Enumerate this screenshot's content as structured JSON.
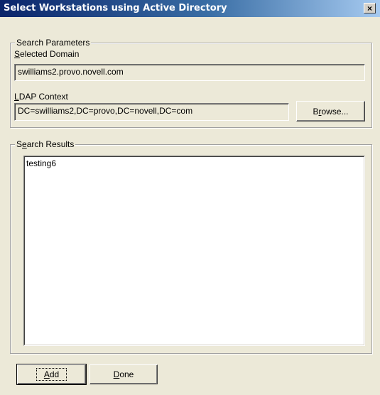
{
  "window": {
    "title": "Select Workstations using Active Directory",
    "close_glyph": "×"
  },
  "search_parameters": {
    "group_label": "Search Parameters",
    "domain_label": "Selected Domain",
    "domain_value": "swilliams2.provo.novell.com",
    "ldap_label": "LDAP Context",
    "ldap_value": "DC=swilliams2,DC=provo,DC=novell,DC=com",
    "browse_label": "Browse..."
  },
  "search_results": {
    "group_label": "Search Results",
    "items": [
      "testing6"
    ]
  },
  "buttons": {
    "add_label": "Add",
    "done_label": "Done"
  },
  "icons": {
    "close": "close-icon"
  }
}
